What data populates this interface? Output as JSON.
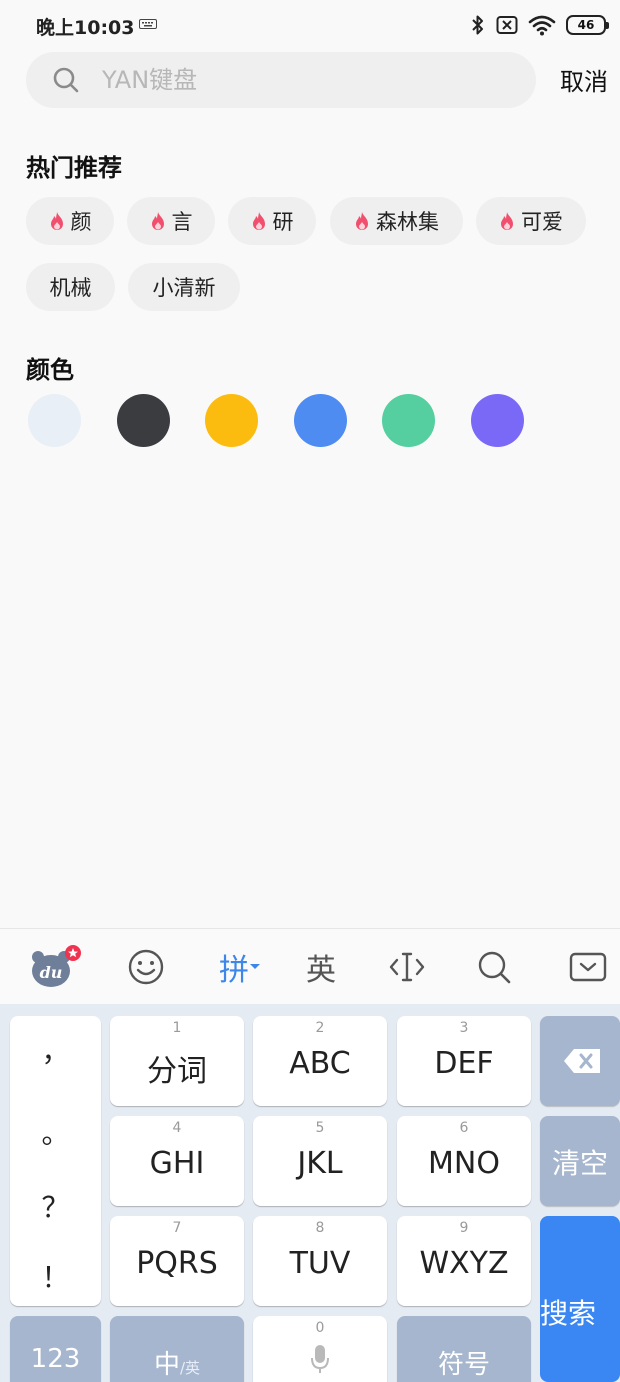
{
  "status_bar": {
    "time": "晚上10:03",
    "battery": "46"
  },
  "search": {
    "placeholder": "YAN键盘",
    "value": "",
    "cancel_label": "取消"
  },
  "hot": {
    "title": "热门推荐",
    "tags": [
      "颜",
      "言",
      "研",
      "森林集",
      "可爱",
      "机械",
      "小清新"
    ]
  },
  "colors": {
    "title": "颜色",
    "swatches": [
      "#e9eff6",
      "#3b3c40",
      "#fcbb0f",
      "#4e8cf2",
      "#55cfa0",
      "#7a69f7"
    ]
  },
  "keyboard": {
    "toolbar": {
      "logo_text": "du",
      "pinyin": "拼",
      "english": "英"
    },
    "keys": {
      "punct": [
        "，",
        "。",
        "？",
        "！"
      ],
      "k1": {
        "num": "1",
        "label": "分词"
      },
      "k2": {
        "num": "2",
        "label": "ABC"
      },
      "k3": {
        "num": "3",
        "label": "DEF"
      },
      "k4": {
        "num": "4",
        "label": "GHI"
      },
      "k5": {
        "num": "5",
        "label": "JKL"
      },
      "k6": {
        "num": "6",
        "label": "MNO"
      },
      "k7": {
        "num": "7",
        "label": "PQRS"
      },
      "k8": {
        "num": "8",
        "label": "TUV"
      },
      "k9": {
        "num": "9",
        "label": "WXYZ"
      },
      "k0": {
        "num": "0"
      },
      "clear": "清空",
      "search": "搜索",
      "numbers": "123",
      "lang_main": "中",
      "lang_sub": "/英",
      "symbols": "符号"
    }
  },
  "accent_color": "#3a86f2",
  "flame_color": "#f0506e"
}
